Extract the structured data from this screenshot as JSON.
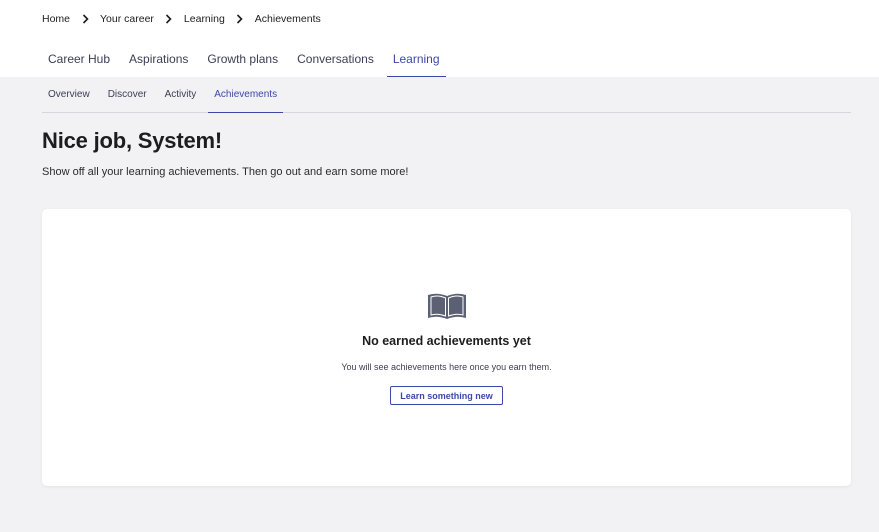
{
  "breadcrumb": {
    "items": [
      {
        "label": "Home"
      },
      {
        "label": "Your career"
      },
      {
        "label": "Learning"
      },
      {
        "label": "Achievements"
      }
    ]
  },
  "main_tabs": [
    {
      "label": "Career Hub"
    },
    {
      "label": "Aspirations"
    },
    {
      "label": "Growth plans"
    },
    {
      "label": "Conversations"
    },
    {
      "label": "Learning",
      "active": true
    }
  ],
  "sub_tabs": [
    {
      "label": "Overview"
    },
    {
      "label": "Discover"
    },
    {
      "label": "Activity"
    },
    {
      "label": "Achievements",
      "active": true
    }
  ],
  "page": {
    "title": "Nice job, System!",
    "subtitle": "Show off all your learning achievements. Then go out and earn some more!"
  },
  "empty_state": {
    "icon": "open-book-icon",
    "title": "No earned achievements yet",
    "description": "You will see achievements here once you earn them.",
    "button_label": "Learn something new"
  },
  "colors": {
    "accent": "#3c48a5",
    "background": "#f2f2f4",
    "icon": "#5b6075"
  }
}
